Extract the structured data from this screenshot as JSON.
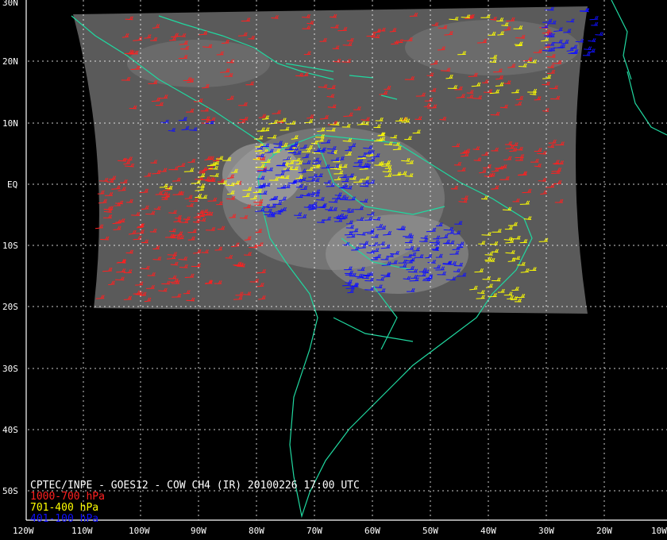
{
  "title": "CPTEC/INPE - GOES12 - COW CH4 (IR) 20100226 17:00 UTC",
  "legend": [
    {
      "label": "1000-700 hPa",
      "color": "#ff2020"
    },
    {
      "label": "701-400 hPa",
      "color": "#ffff00"
    },
    {
      "label": "401-100 hPa",
      "color": "#1010ff"
    }
  ],
  "lat_labels": [
    "30N",
    "20N",
    "10N",
    "EQ",
    "10S",
    "20S",
    "30S",
    "40S",
    "50S"
  ],
  "lon_labels": [
    "120W",
    "110W",
    "100W",
    "90W",
    "80W",
    "70W",
    "60W",
    "50W",
    "40W",
    "30W",
    "20W",
    "10W"
  ],
  "colors": {
    "background": "#000000",
    "coastline": "#20d8a0",
    "grid": "#ffffff",
    "ir_imagery": "#5a5a5a"
  }
}
